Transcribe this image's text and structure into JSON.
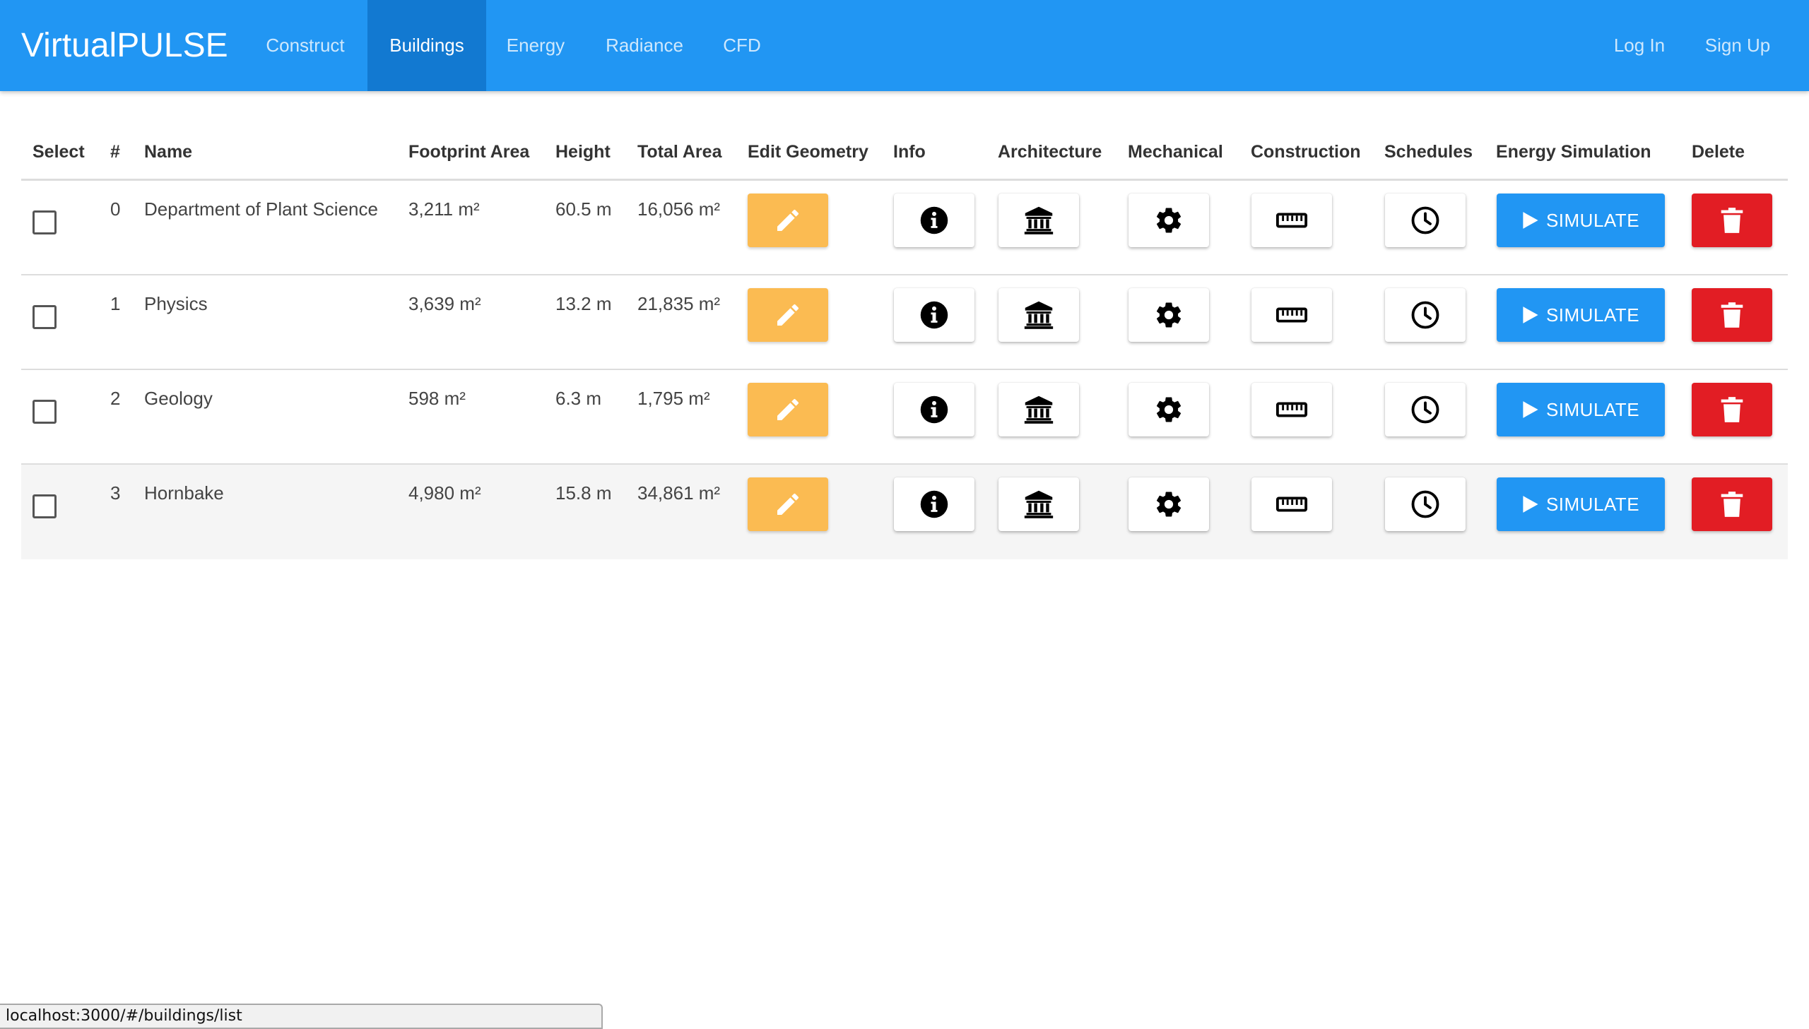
{
  "app": {
    "brand": "VirtualPULSE"
  },
  "nav": {
    "items": [
      {
        "label": "Construct",
        "active": false
      },
      {
        "label": "Buildings",
        "active": true
      },
      {
        "label": "Energy",
        "active": false
      },
      {
        "label": "Radiance",
        "active": false
      },
      {
        "label": "CFD",
        "active": false
      }
    ],
    "login": "Log In",
    "signup": "Sign Up"
  },
  "table": {
    "headers": {
      "select": "Select",
      "index": "#",
      "name": "Name",
      "footprint": "Footprint Area",
      "height": "Height",
      "total": "Total Area",
      "edit": "Edit Geometry",
      "info": "Info",
      "architecture": "Architecture",
      "mechanical": "Mechanical",
      "construction": "Construction",
      "schedules": "Schedules",
      "energy": "Energy Simulation",
      "delete": "Delete"
    },
    "simulate_label": "SIMULATE",
    "rows": [
      {
        "index": "0",
        "name": "Department of Plant Science",
        "footprint": "3,211 m²",
        "height": "60.5 m",
        "total": "16,056 m²",
        "selected": false
      },
      {
        "index": "1",
        "name": "Physics",
        "footprint": "3,639 m²",
        "height": "13.2 m",
        "total": "21,835 m²",
        "selected": false
      },
      {
        "index": "2",
        "name": "Geology",
        "footprint": "598 m²",
        "height": "6.3 m",
        "total": "1,795 m²",
        "selected": false
      },
      {
        "index": "3",
        "name": "Hornbake",
        "footprint": "4,980 m²",
        "height": "15.8 m",
        "total": "34,861 m²",
        "selected": false
      }
    ]
  },
  "icons": {
    "edit": "pencil-icon",
    "info": "info-circle-icon",
    "architecture": "institution-icon",
    "mechanical": "gear-icon",
    "construction": "ruler-icon",
    "schedules": "clock-icon",
    "simulate": "play-icon",
    "delete": "trash-icon"
  },
  "colors": {
    "primary": "#2196f3",
    "active_tab": "#1279d1",
    "edit": "#fbbb52",
    "delete": "#e21d24"
  },
  "status": {
    "url": "localhost:3000/#/buildings/list"
  }
}
